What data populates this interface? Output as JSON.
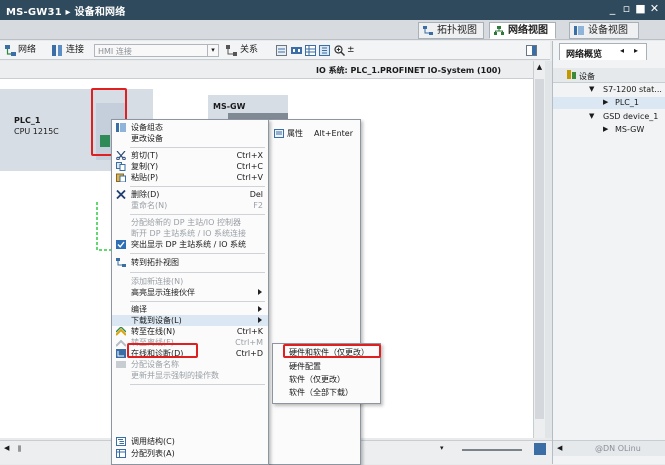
{
  "window": {
    "title": "MS-GW31 ▸ 设备和网络",
    "controls": [
      "minimize",
      "restore",
      "maximize",
      "close"
    ]
  },
  "view_tabs": [
    {
      "label": "拓扑视图",
      "icon": "topology-icon",
      "active": false
    },
    {
      "label": "网络视图",
      "icon": "network-icon",
      "active": true
    },
    {
      "label": "设备视图",
      "icon": "device-icon",
      "active": false
    }
  ],
  "toolbar": {
    "network_label": "网络",
    "connections_label": "连接",
    "connection_type_value": "HMI 连接",
    "relations_label": "关系",
    "zoom_label": "±"
  },
  "io_bar": {
    "text": "IO 系统: PLC_1.PROFINET IO-System (100)"
  },
  "canvas": {
    "device1": {
      "name": "PLC_1",
      "type": "CPU 1215C"
    },
    "device2": {
      "name": "MS-GW"
    }
  },
  "overview": {
    "tab_label": "网络概览",
    "header_label": "设备",
    "items": [
      {
        "label": "S7-1200 stat...",
        "level": 1,
        "expanded": true
      },
      {
        "label": "PLC_1",
        "level": 2,
        "expanded": false
      },
      {
        "label": "GSD device_1",
        "level": 1,
        "expanded": true
      },
      {
        "label": "MS-GW",
        "level": 2,
        "expanded": false
      }
    ]
  },
  "context_menu": {
    "items": [
      {
        "label": "设备组态",
        "icon": "device-config-icon"
      },
      {
        "label": "更改设备"
      },
      {
        "label": "剪切(T)",
        "shortcut": "Ctrl+X",
        "icon": "cut-icon"
      },
      {
        "label": "复制(Y)",
        "shortcut": "Ctrl+C",
        "icon": "copy-icon"
      },
      {
        "label": "粘贴(P)",
        "shortcut": "Ctrl+V",
        "icon": "paste-icon"
      },
      {
        "label": "删除(D)",
        "shortcut": "Del",
        "icon": "delete-icon"
      },
      {
        "label": "重命名(N)",
        "shortcut": "F2",
        "disabled": true
      },
      {
        "label": "分配给新的 DP 主站/IO 控制器",
        "disabled": true
      },
      {
        "label": "断开 DP 主站系统 / IO 系统连接",
        "disabled": true
      },
      {
        "label": "突出显示 DP 主站系统 / IO 系统",
        "icon": "checkbox-icon"
      },
      {
        "label": "转到拓扑视图",
        "icon": "topology-icon"
      },
      {
        "label": "添加新连接(N)",
        "disabled": true
      },
      {
        "label": "高亮显示连接伙伴",
        "submenu": true
      },
      {
        "label": "编译",
        "submenu": true
      },
      {
        "label": "下载到设备(L)",
        "submenu": true
      },
      {
        "label": "转至在线(N)",
        "shortcut": "Ctrl+K",
        "icon": "go-online-icon"
      },
      {
        "label": "转至离线(F)",
        "shortcut": "Ctrl+M",
        "disabled": true,
        "icon": "go-offline-icon"
      },
      {
        "label": "在线和诊断(D)",
        "shortcut": "Ctrl+D",
        "icon": "diagnostics-icon"
      },
      {
        "label": "分配设备名称",
        "disabled": true,
        "icon": "assign-name-icon"
      },
      {
        "label": "更新并显示强制的操作数",
        "disabled": true
      },
      {
        "label": "调用结构(C)",
        "icon": "call-structure-icon"
      },
      {
        "label": "分配列表(A)",
        "icon": "assignment-list-icon"
      }
    ],
    "properties_label": "属性",
    "properties_shortcut": "Alt+Enter"
  },
  "submenu": {
    "items": [
      {
        "label": "硬件和软件（仅更改）"
      },
      {
        "label": "硬件配置"
      },
      {
        "label": "软件（仅更改）"
      },
      {
        "label": "软件（全部下载）"
      }
    ]
  },
  "statusbar": {
    "watermark": "@DN OLinu"
  },
  "colors": {
    "titlebar": "#2f4a5c",
    "highlight": "#e02020",
    "selected_bg": "#dbe7f3"
  }
}
